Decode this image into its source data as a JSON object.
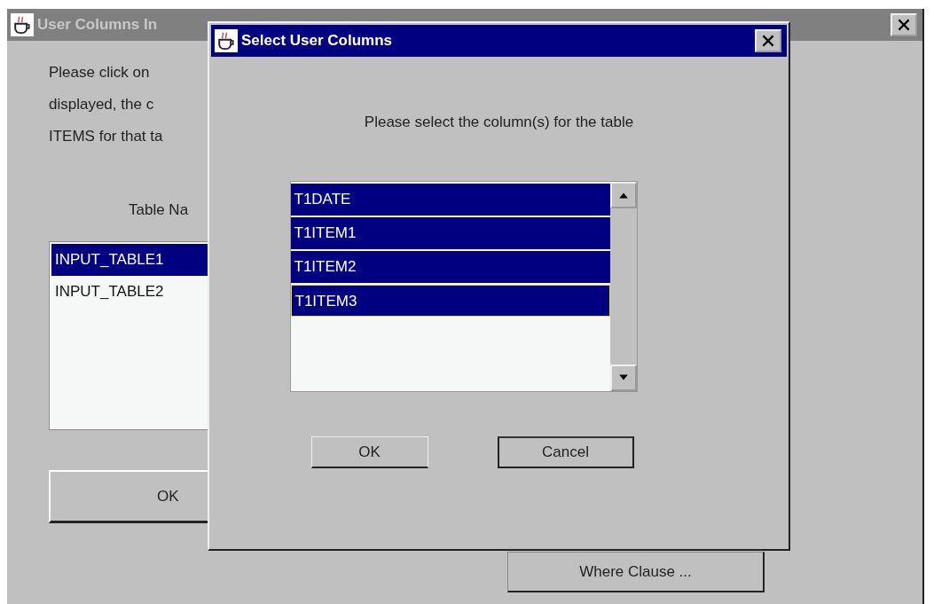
{
  "main_window": {
    "title": "User Columns In",
    "instructions": [
      "Please click on",
      "displayed, the c",
      "ITEMS for that ta"
    ],
    "list_label": "Table Na",
    "tables": [
      {
        "name": "INPUT_TABLE1",
        "selected": true
      },
      {
        "name": "INPUT_TABLE2",
        "selected": false
      }
    ],
    "ok_button": "OK",
    "where_button": "Where Clause ..."
  },
  "dialog": {
    "title": "Select User Columns",
    "prompt": "Please select the column(s) for the table",
    "columns": [
      {
        "name": "T1DATE",
        "selected": true,
        "focused": false
      },
      {
        "name": "T1ITEM1",
        "selected": true,
        "focused": false
      },
      {
        "name": "T1ITEM2",
        "selected": true,
        "focused": false
      },
      {
        "name": "T1ITEM3",
        "selected": true,
        "focused": true
      }
    ],
    "buttons": [
      "OK",
      "Cancel"
    ]
  }
}
